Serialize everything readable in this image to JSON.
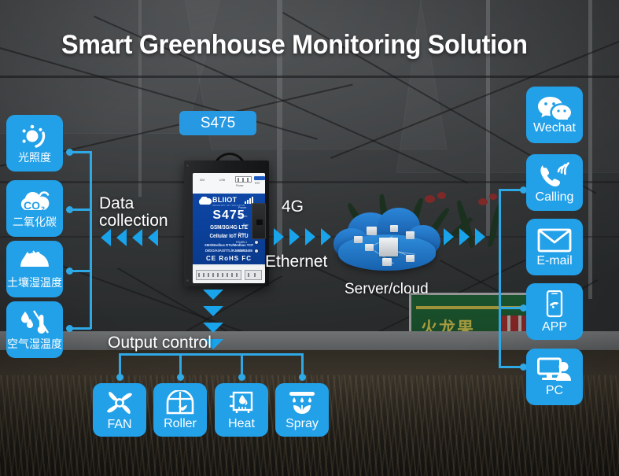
{
  "page": {
    "title": "Smart Greenhouse Monitoring Solution",
    "accent_blue": "#22a0e8",
    "arrow_blue": "#18a3ea",
    "line_blue": "#2fa8e6",
    "device_blue": "#0e47a6"
  },
  "device_tag": {
    "label": "S475"
  },
  "device": {
    "brand": "BLIIOT",
    "brand_sub": "INDUSTRY IOT SOLUTION",
    "model": "S475",
    "line_a": "GSM/3G/4G LTE",
    "line_b": "Cellular IoT RTU",
    "line_c": "SMS/Modbus RTU/Modbus TCP",
    "line_d": "DI/DO/AI/AO/TTL/RJ45/2RS485",
    "certs": "CE RoHS FC",
    "top_labels": [
      "SIM",
      "USB",
      "Power",
      "RST"
    ],
    "led_labels": [
      "Power",
      "Alarm",
      "Run",
      "Status",
      "RS485-1",
      "RS485-2"
    ],
    "terminal_labels": [
      "RS485-1",
      "RS485-2",
      "DI/DO",
      "AI/AO",
      "Power"
    ],
    "side_label": "Ethernet"
  },
  "flow": {
    "data_collection": "Data\ncollection",
    "data_collection_line1": "Data",
    "data_collection_line2": "collection",
    "uplink_top": "4G",
    "uplink_bottom": "Ethernet",
    "cloud_label": "Server/cloud",
    "output_control": "Output control"
  },
  "sensors": [
    {
      "icon": "sun-light-icon",
      "label": "光照度",
      "name": "sensor-illuminance"
    },
    {
      "icon": "co2-cloud-icon",
      "label": "二氧化碳",
      "name": "sensor-co2"
    },
    {
      "icon": "soil-temp-humid-icon",
      "label": "土壤湿温度",
      "name": "sensor-soil-temp-humidity"
    },
    {
      "icon": "air-temp-humid-icon",
      "label": "空气湿温度",
      "name": "sensor-air-temp-humidity"
    }
  ],
  "actuators": [
    {
      "icon": "fan-icon",
      "label": "FAN",
      "name": "actuator-fan"
    },
    {
      "icon": "roller-icon",
      "label": "Roller",
      "name": "actuator-roller"
    },
    {
      "icon": "heat-icon",
      "label": "Heat",
      "name": "actuator-heat"
    },
    {
      "icon": "spray-icon",
      "label": "Spray",
      "name": "actuator-spray"
    }
  ],
  "channels": [
    {
      "icon": "wechat-icon",
      "label": "Wechat",
      "name": "channel-wechat"
    },
    {
      "icon": "phone-icon",
      "label": "Calling",
      "name": "channel-calling"
    },
    {
      "icon": "envelope-icon",
      "label": "E-mail",
      "name": "channel-email"
    },
    {
      "icon": "mobile-icon",
      "label": "APP",
      "name": "channel-app"
    },
    {
      "icon": "monitor-user-icon",
      "label": "PC",
      "name": "channel-pc"
    }
  ],
  "background": {
    "sign_text": "火龙果"
  }
}
